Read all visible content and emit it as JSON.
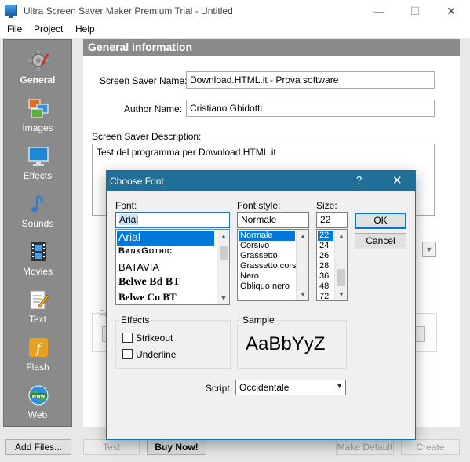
{
  "window": {
    "title": "Ultra Screen Saver Maker Premium Trial - Untitled",
    "minimize": "—",
    "maximize": "☐",
    "close": "✕"
  },
  "menu": [
    "File",
    "Project",
    "Help"
  ],
  "sidebar": {
    "items": [
      {
        "label": "General",
        "icon": "gear-icon"
      },
      {
        "label": "Images",
        "icon": "images-icon"
      },
      {
        "label": "Effects",
        "icon": "monitor-icon"
      },
      {
        "label": "Sounds",
        "icon": "music-note-icon"
      },
      {
        "label": "Movies",
        "icon": "film-strip-icon"
      },
      {
        "label": "Text",
        "icon": "notepad-icon"
      },
      {
        "label": "Flash",
        "icon": "flash-icon"
      },
      {
        "label": "Web",
        "icon": "globe-icon"
      }
    ]
  },
  "general": {
    "header": "General information",
    "name_label": "Screen Saver Name:",
    "name_value": "Download.HTML.it - Prova software",
    "author_label": "Author Name:",
    "author_value": "Cristiano Ghidotti",
    "desc_label": "Screen Saver Description:",
    "desc_value": "Test del programma per Download.HTML.it",
    "hidden_label": "Fo"
  },
  "bottom": {
    "add_files": "Add Files...",
    "test": "Test",
    "buy_now": "Buy Now!",
    "make_default": "Make Default",
    "create": "Create"
  },
  "dialog": {
    "title": "Choose Font",
    "help": "?",
    "close": "✕",
    "font_label": "Font:",
    "font_value": "Arial",
    "fonts": [
      "Arial",
      "BankGothic",
      "BATAVIA",
      "Belwe Bd BT",
      "Belwe Cn BT"
    ],
    "style_label": "Font style:",
    "style_value": "Normale",
    "styles": [
      "Normale",
      "Corsivo",
      "Grassetto",
      "Grassetto cors",
      "Nero",
      "Obliquo nero"
    ],
    "size_label": "Size:",
    "size_value": "22",
    "sizes": [
      "22",
      "24",
      "26",
      "28",
      "36",
      "48",
      "72"
    ],
    "ok": "OK",
    "cancel": "Cancel",
    "effects_label": "Effects",
    "strikeout": "Strikeout",
    "underline": "Underline",
    "sample_label": "Sample",
    "sample_text": "AaBbYyZ",
    "script_label": "Script:",
    "script_value": "Occidentale"
  }
}
